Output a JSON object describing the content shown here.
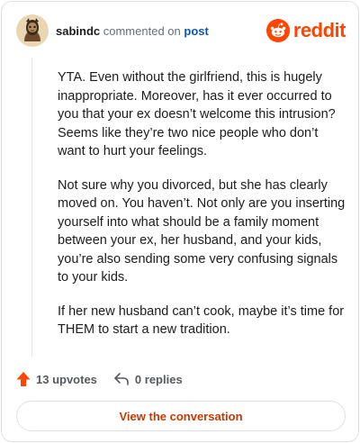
{
  "header": {
    "username": "sabindc",
    "action_text": "commented on",
    "post_link": "post",
    "brand": "reddit"
  },
  "comment": {
    "paragraphs": [
      "YTA. Even without the girlfriend, this is hugely inappropriate. Moreover, has it ever occurred to you that your ex doesn’t welcome this intrusion? Seems like they’re two nice people who don’t want to hurt your feelings.",
      "Not sure why you divorced, but she has clearly moved on. You haven’t. Not only are you inserting yourself into what should be a family moment between your ex, her husband, and your kids, you’re also sending some very confusing signals to your kids.",
      "If her new husband can’t cook, maybe it’s time for THEM to start a new tradition."
    ]
  },
  "actions": {
    "upvotes": "13 upvotes",
    "replies": "0 replies"
  },
  "cta": {
    "label": "View the conversation"
  },
  "colors": {
    "brand": "#ff4500",
    "link": "#0b57b5",
    "cta_text": "#c43a00"
  }
}
